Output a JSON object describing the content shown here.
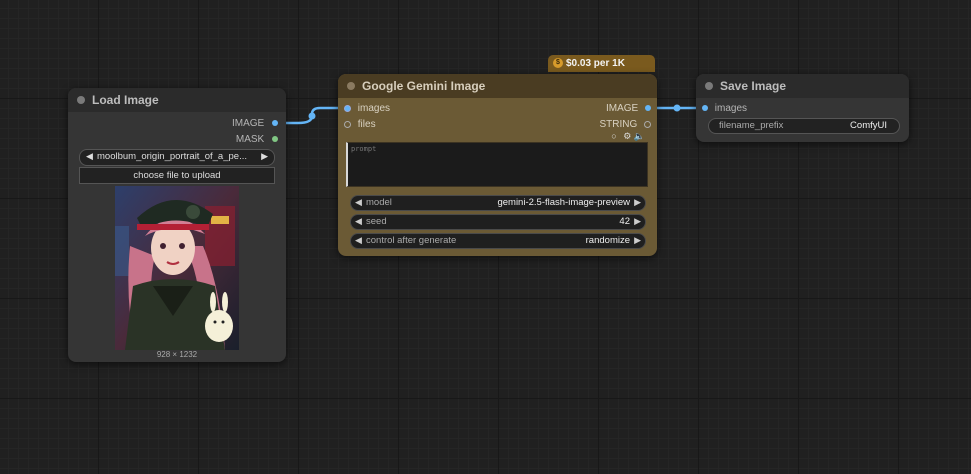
{
  "nodes": {
    "load_image": {
      "title": "Load Image",
      "outputs": [
        "IMAGE",
        "MASK"
      ],
      "image_combo": "moolbum_origin_portrait_of_a_pe...",
      "upload_button": "choose file to upload",
      "image_size": "928 × 1232"
    },
    "gemini": {
      "title": "Google Gemini Image",
      "price_badge": "$0.03 per 1K tokens",
      "inputs": [
        "images",
        "files"
      ],
      "outputs": [
        "IMAGE",
        "STRING"
      ],
      "prompt_placeholder": "prompt",
      "widgets": [
        {
          "label": "model",
          "value": "gemini-2.5-flash-image-preview"
        },
        {
          "label": "seed",
          "value": "42"
        },
        {
          "label": "control after generate",
          "value": "randomize"
        }
      ]
    },
    "save_image": {
      "title": "Save Image",
      "inputs": [
        "images"
      ],
      "filename_prefix_label": "filename_prefix",
      "filename_prefix_value": "ComfyUI"
    }
  },
  "colors": {
    "image_slot": "#64b5f6",
    "mask_slot": "#81c784",
    "gemini_body": "#6b5a35",
    "gemini_header": "#4a3c22",
    "link": "#64b5f6"
  },
  "icons": [
    "coin-icon",
    "toggle-circle-icon",
    "gear-icon",
    "speaker-icon"
  ]
}
